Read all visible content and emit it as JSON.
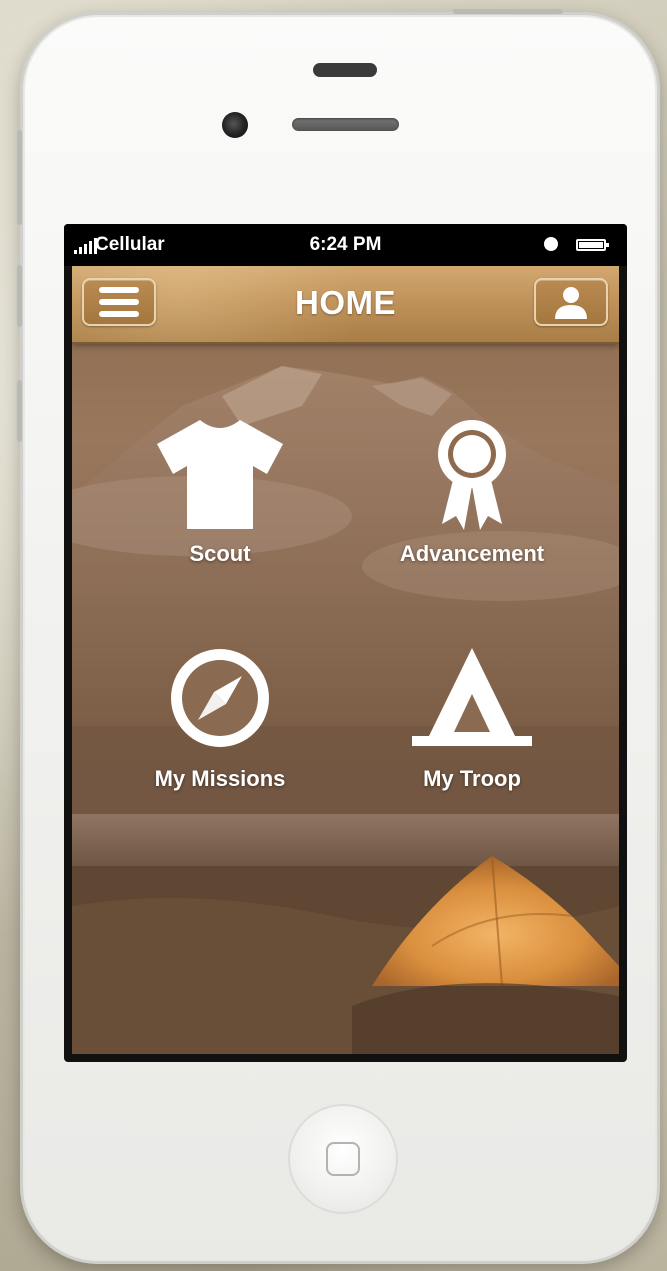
{
  "status_bar": {
    "carrier": "Cellular",
    "time": "6:24 PM"
  },
  "navbar": {
    "title": "HOME"
  },
  "tiles": [
    {
      "label": "Scout",
      "icon": "t-shirt-icon"
    },
    {
      "label": "Advancement",
      "icon": "ribbon-award-icon"
    },
    {
      "label": "My Missions",
      "icon": "compass-icon"
    },
    {
      "label": "My Troop",
      "icon": "tent-icon"
    }
  ],
  "colors": {
    "navbar": "#c0935a",
    "background": "#8e6b4f",
    "text": "#ffffff"
  }
}
